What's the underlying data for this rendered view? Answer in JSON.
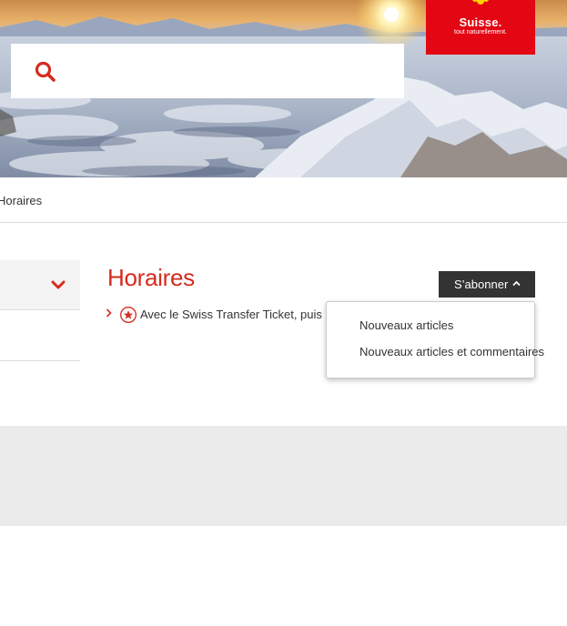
{
  "logo": {
    "wordmark": "Suisse.",
    "tagline": "tout naturellement."
  },
  "search": {
    "placeholder": "",
    "value": ""
  },
  "breadcrumb": {
    "current": "Horaires"
  },
  "page": {
    "title": "Horaires"
  },
  "article": {
    "text": "Avec le Swiss Transfer Ticket, puis"
  },
  "subscribe": {
    "label": "S’abonner",
    "options": [
      "Nouveaux articles",
      "Nouveaux articles et commentaires"
    ]
  },
  "icons": {
    "search": "search-icon",
    "nav_toggle": "chevron-down-icon",
    "row": "chevron-right-icon",
    "featured": "star-circle-icon",
    "subscribe_caret": "chevron-up-icon"
  },
  "colors": {
    "brand_red": "#d52b1e",
    "logo_red": "#e30613",
    "button_dark": "#333333",
    "band_grey": "#ebebeb"
  }
}
